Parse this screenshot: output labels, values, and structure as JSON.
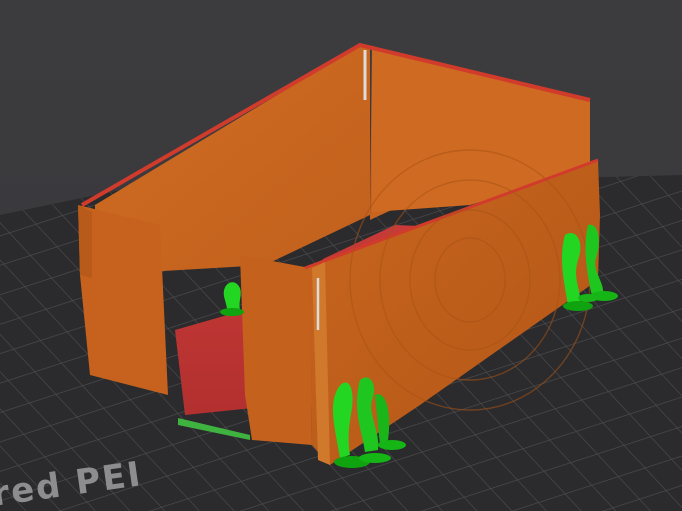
{
  "viewport": {
    "bed_label": "red PEI"
  },
  "colors": {
    "background": "#3a3a3d",
    "bed_surface": "#2a2a2c",
    "bed_grid": "#4a4a4d",
    "perimeter": "#c8651f",
    "perimeter_dark": "#a94f15",
    "outer_edge": "#d03b2c",
    "solid_infill": "#cc3a3a",
    "support": "#22d622",
    "support_dark": "#0fa30f",
    "seam": "#d8d8d8"
  },
  "icons": {
    "model": "sliced-box-model",
    "supports": "tree-support-icon"
  }
}
